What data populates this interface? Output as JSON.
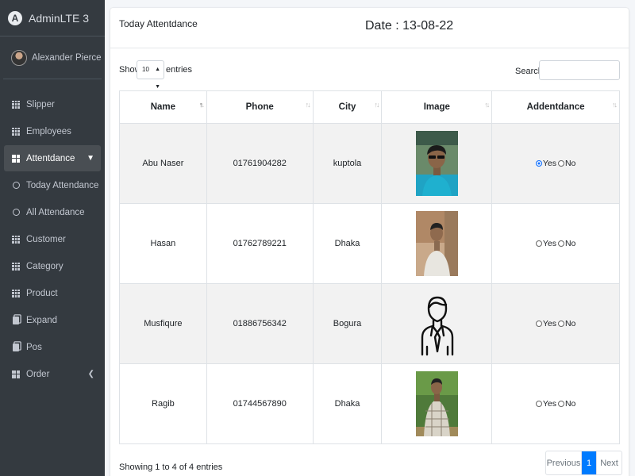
{
  "brand": {
    "name": "AdminLTE 3",
    "logo_letter": "A"
  },
  "user": {
    "name": "Alexander Pierce"
  },
  "sidebar": {
    "items": [
      {
        "label": "Slipper",
        "icon": "grid-icon"
      },
      {
        "label": "Employees",
        "icon": "grid-icon"
      },
      {
        "label": "Attentdance",
        "icon": "table-icon",
        "active": true,
        "caret": "chevron-down-icon"
      },
      {
        "label": "Today Attendance",
        "icon": "circle-icon"
      },
      {
        "label": "All Attendance",
        "icon": "circle-icon"
      },
      {
        "label": "Customer",
        "icon": "grid-icon"
      },
      {
        "label": "Category",
        "icon": "grid-icon"
      },
      {
        "label": "Product",
        "icon": "grid-icon"
      },
      {
        "label": "Expand",
        "icon": "copy-icon"
      },
      {
        "label": "Pos",
        "icon": "copy-icon"
      },
      {
        "label": "Order",
        "icon": "table-icon",
        "caret": "chevron-left-icon"
      }
    ]
  },
  "card": {
    "title": "Today Attentdance",
    "date": "Date : 13-08-22"
  },
  "controls": {
    "show": "Show",
    "entries_value": "10",
    "entries": "entries",
    "search_label": "Search:"
  },
  "table": {
    "headers": [
      "Name",
      "Phone",
      "City",
      "Image",
      "Addentdance"
    ],
    "rows": [
      {
        "name": "Abu Naser",
        "phone": "01761904282",
        "city": "kuptola",
        "image": "photo-man-sunglasses",
        "yes": "Yes",
        "no": "No",
        "selected": "Yes"
      },
      {
        "name": "Hasan",
        "phone": "01762789221",
        "city": "Dhaka",
        "image": "photo-man-white-shirt",
        "yes": "Yes",
        "no": "No",
        "selected": ""
      },
      {
        "name": "Musfiqure",
        "phone": "01886756342",
        "city": "Bogura",
        "image": "person-outline-icon",
        "yes": "Yes",
        "no": "No",
        "selected": ""
      },
      {
        "name": "Ragib",
        "phone": "01744567890",
        "city": "Dhaka",
        "image": "photo-man-checked-shirt",
        "yes": "Yes",
        "no": "No",
        "selected": ""
      }
    ]
  },
  "footer": {
    "info": "Showing 1 to 4 of 4 entries",
    "previous": "Previous",
    "page": "1",
    "next": "Next"
  }
}
